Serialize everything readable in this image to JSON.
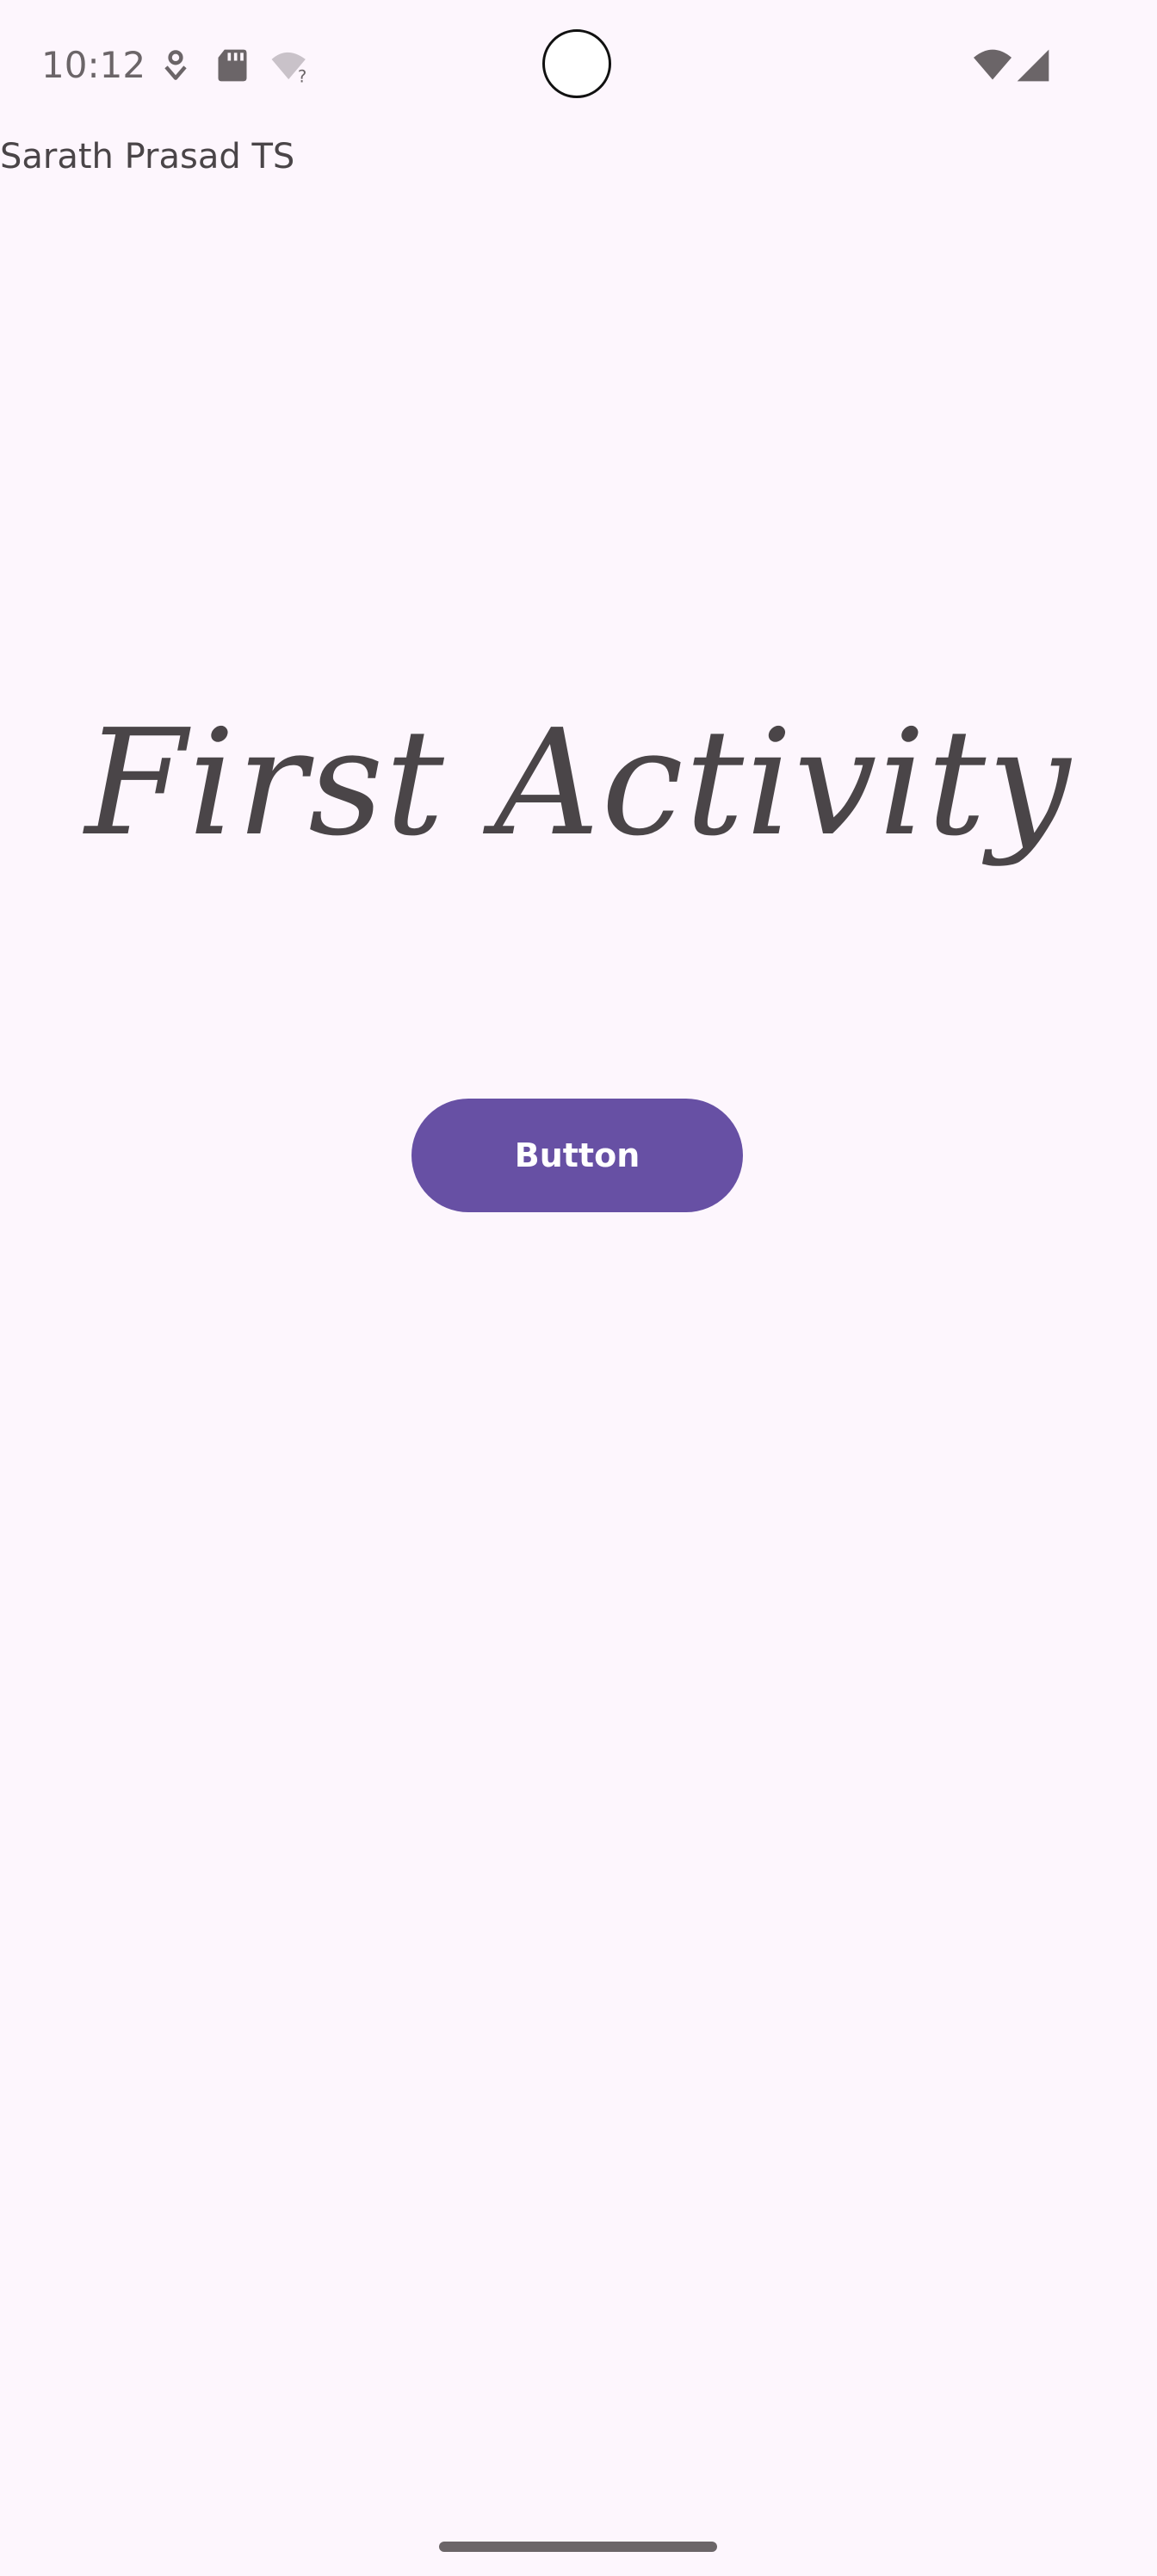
{
  "status_bar": {
    "time": "10:12",
    "icons": {
      "left": [
        "location-pin-icon",
        "sd-card-icon",
        "wifi-unknown-icon"
      ],
      "right": [
        "wifi-icon",
        "cell-signal-icon"
      ]
    }
  },
  "main": {
    "owner_label": "Sarath Prasad TS",
    "headline": "First Activity",
    "button_label": "Button"
  },
  "colors": {
    "background": "#fdf6fd",
    "text": "#4a4548",
    "button": "#6750a4",
    "button_text": "#ffffff",
    "status_icons": "#6b6568"
  }
}
